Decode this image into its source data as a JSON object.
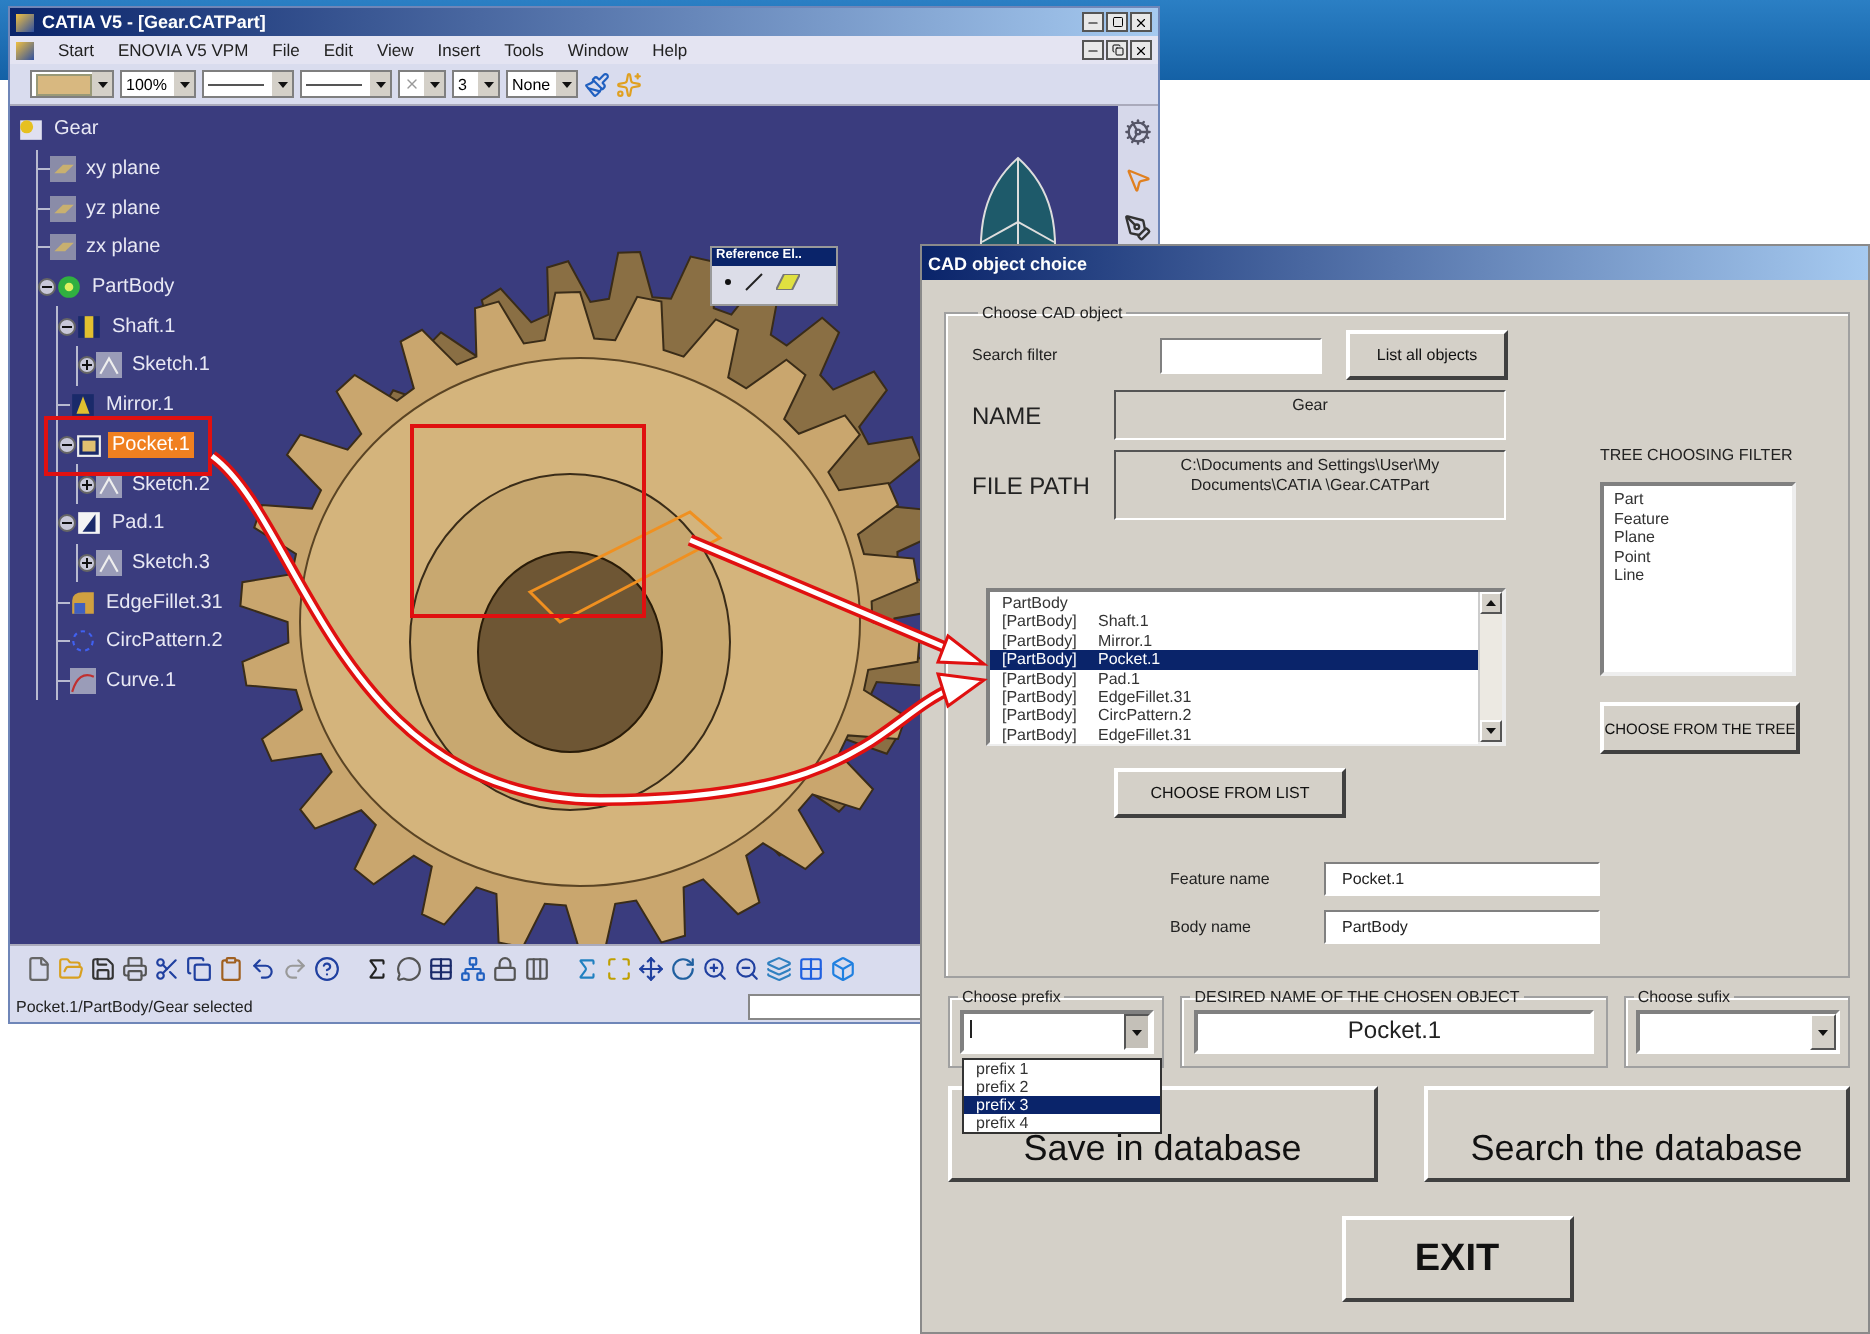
{
  "catia_window": {
    "title": "CATIA V5 - [Gear.CATPart]",
    "menu": [
      "Start",
      "ENOVIA V5 VPM",
      "File",
      "Edit",
      "View",
      "Insert",
      "Tools",
      "Window",
      "Help"
    ],
    "toolbar": {
      "zoom": "100%",
      "layer": "3",
      "filter": "None"
    },
    "tree": {
      "label": "Gear",
      "kind": "root",
      "selected": false,
      "children": [
        {
          "label": "xy plane",
          "kind": "plane",
          "selected": false
        },
        {
          "label": "yz plane",
          "kind": "plane",
          "selected": false
        },
        {
          "label": "zx plane",
          "kind": "plane",
          "selected": false
        },
        {
          "label": "PartBody",
          "kind": "body",
          "selected": false,
          "expanded": true,
          "children": [
            {
              "label": "Shaft.1",
              "kind": "shaft",
              "selected": false,
              "expanded": true,
              "children": [
                {
                  "label": "Sketch.1",
                  "kind": "sketch",
                  "selected": false,
                  "expanded": false
                }
              ]
            },
            {
              "label": "Mirror.1",
              "kind": "mirror",
              "selected": false
            },
            {
              "label": "Pocket.1",
              "kind": "pocket",
              "selected": true,
              "expanded": true,
              "children": [
                {
                  "label": "Sketch.2",
                  "kind": "sketch",
                  "selected": false,
                  "expanded": false
                }
              ]
            },
            {
              "label": "Pad.1",
              "kind": "pad",
              "selected": false,
              "expanded": true,
              "children": [
                {
                  "label": "Sketch.3",
                  "kind": "sketch",
                  "selected": false,
                  "expanded": false
                }
              ]
            },
            {
              "label": "EdgeFillet.31",
              "kind": "fillet",
              "selected": false
            },
            {
              "label": "CircPattern.2",
              "kind": "pattern",
              "selected": false
            },
            {
              "label": "Curve.1",
              "kind": "curve",
              "selected": false
            }
          ]
        }
      ]
    },
    "reference_toolbar": {
      "title": "Reference El.."
    },
    "status": "Pocket.1/PartBody/Gear selected"
  },
  "dialog": {
    "title": "CAD object choice",
    "object_group": {
      "title": "Choose CAD object",
      "search_label": "Search filter",
      "list_all_button": "List all objects",
      "name_label": "NAME",
      "name_value": "Gear",
      "path_label": "FILE PATH",
      "path_value": "C:\\Documents and Settings\\User\\My Documents\\CATIA \\Gear.CATPart",
      "objects": [
        {
          "columns": [
            "PartBody"
          ],
          "selected": false
        },
        {
          "columns": [
            "[PartBody]",
            "Shaft.1"
          ],
          "selected": false
        },
        {
          "columns": [
            "[PartBody]",
            "Mirror.1"
          ],
          "selected": false
        },
        {
          "columns": [
            "[PartBody]",
            "Pocket.1"
          ],
          "selected": true
        },
        {
          "columns": [
            "[PartBody]",
            "Pad.1"
          ],
          "selected": false
        },
        {
          "columns": [
            "[PartBody]",
            "EdgeFillet.31"
          ],
          "selected": false
        },
        {
          "columns": [
            "[PartBody]",
            "CircPattern.2"
          ],
          "selected": false
        },
        {
          "columns": [
            "[PartBody]",
            "EdgeFillet.31"
          ],
          "selected": false
        }
      ],
      "choose_list_button": "CHOOSE FROM LIST",
      "filter_title": "TREE CHOOSING FILTER",
      "filters": [
        {
          "label": "Part",
          "selected": false
        },
        {
          "label": "Feature",
          "selected": false
        },
        {
          "label": "Plane",
          "selected": false
        },
        {
          "label": "Point",
          "selected": false
        },
        {
          "label": "Line",
          "selected": false
        }
      ],
      "choose_tree_button": "CHOOSE FROM THE TREE",
      "feature_label": "Feature name",
      "feature_value": "Pocket.1",
      "body_label": "Body name",
      "body_value": "PartBody"
    },
    "prefix": {
      "title": "Choose prefix",
      "expanded": true,
      "options": [
        {
          "label": "prefix 1",
          "selected": false
        },
        {
          "label": "prefix 2",
          "selected": false
        },
        {
          "label": "prefix 3",
          "selected": true
        },
        {
          "label": "prefix 4",
          "selected": false
        }
      ]
    },
    "desired": {
      "title": "DESIRED NAME OF THE CHOSEN OBJECT",
      "value": "Pocket.1"
    },
    "suffix": {
      "title": "Choose sufix"
    },
    "save_button": "Save in database",
    "search_button": "Search the database",
    "exit_button": "EXIT"
  }
}
